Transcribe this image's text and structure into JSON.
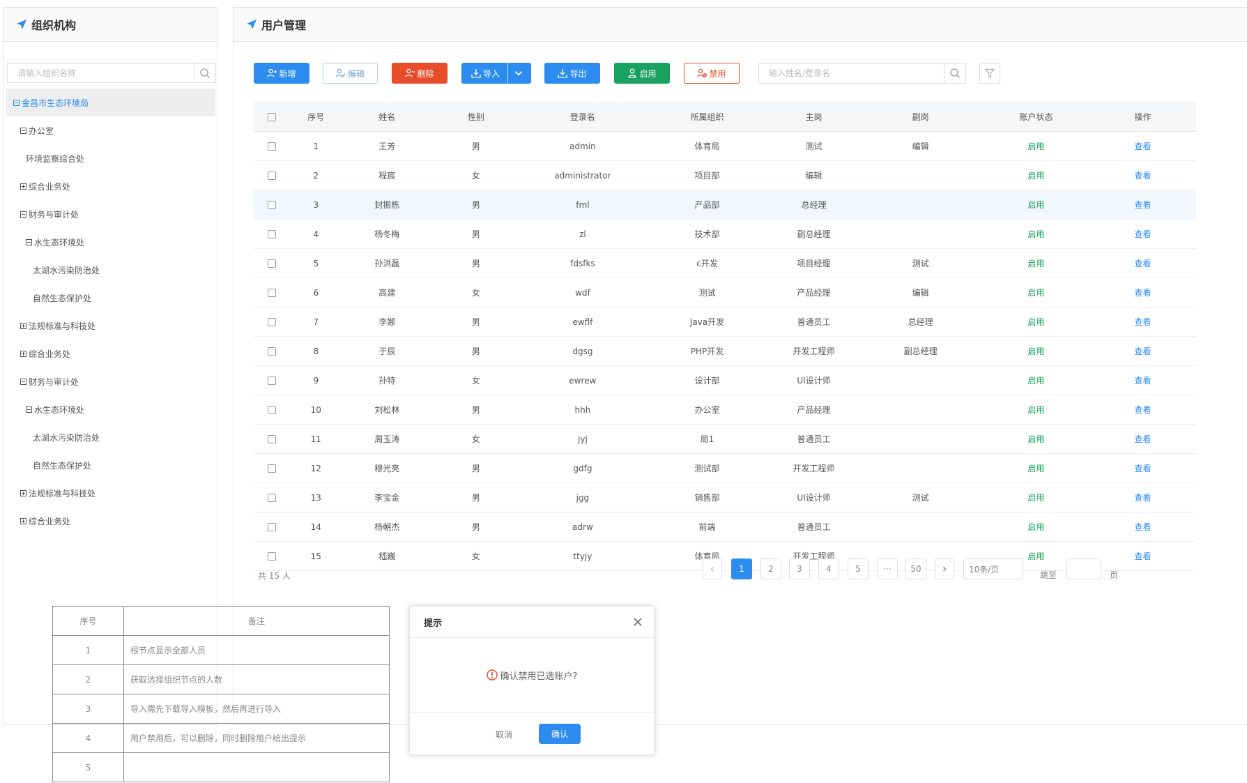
{
  "left_panel": {
    "title": "组织机构",
    "search_placeholder": "请输入组织名称",
    "tree": [
      {
        "label": "金昌市生态环境局",
        "depth": 0,
        "toggle": "minus",
        "selected": true
      },
      {
        "label": "办公室",
        "depth": 1,
        "toggle": "minus"
      },
      {
        "label": "环境监察综合处",
        "depth": 2,
        "toggle": "none"
      },
      {
        "label": "综合业务处",
        "depth": 1,
        "toggle": "plus"
      },
      {
        "label": "财务与审计处",
        "depth": 1,
        "toggle": "minus"
      },
      {
        "label": "水生态环境处",
        "depth": 2,
        "toggle": "minus"
      },
      {
        "label": "太湖水污染防治处",
        "depth": 3,
        "toggle": "none"
      },
      {
        "label": "自然生态保护处",
        "depth": 3,
        "toggle": "none"
      },
      {
        "label": "法规标准与科技处",
        "depth": 1,
        "toggle": "plus"
      },
      {
        "label": "综合业务处",
        "depth": 1,
        "toggle": "plus"
      },
      {
        "label": "财务与审计处",
        "depth": 1,
        "toggle": "minus"
      },
      {
        "label": "水生态环境处",
        "depth": 2,
        "toggle": "minus"
      },
      {
        "label": "太湖水污染防治处",
        "depth": 3,
        "toggle": "none"
      },
      {
        "label": "自然生态保护处",
        "depth": 3,
        "toggle": "none"
      },
      {
        "label": "法规标准与科技处",
        "depth": 1,
        "toggle": "plus"
      },
      {
        "label": "综合业务处",
        "depth": 1,
        "toggle": "plus"
      }
    ]
  },
  "right_panel": {
    "title": "用户管理",
    "toolbar": {
      "add": "新增",
      "edit": "编辑",
      "delete": "删除",
      "import": "导入",
      "export": "导出",
      "enable": "启用",
      "disable": "禁用",
      "search_placeholder": "输入姓名/登录名"
    },
    "table": {
      "columns": [
        "序号",
        "姓名",
        "性别",
        "登录名",
        "所属组织",
        "主岗",
        "副岗",
        "账户状态",
        "操作"
      ],
      "rows": [
        [
          "1",
          "王芳",
          "男",
          "admin",
          "体育局",
          "测试",
          "编辑",
          "启用",
          "查看"
        ],
        [
          "2",
          "程宸",
          "女",
          "administrator",
          "项目部",
          "编辑",
          "",
          "启用",
          "查看"
        ],
        [
          "3",
          "封振栋",
          "男",
          "fml",
          "产品部",
          "总经理",
          "",
          "启用",
          "查看"
        ],
        [
          "4",
          "杨冬梅",
          "男",
          "zl",
          "技术部",
          "副总经理",
          "",
          "启用",
          "查看"
        ],
        [
          "5",
          "孙洪磊",
          "男",
          "fdsfks",
          "c开发",
          "项目经理",
          "测试",
          "启用",
          "查看"
        ],
        [
          "6",
          "高建",
          "女",
          "wdf",
          "测试",
          "产品经理",
          "编辑",
          "启用",
          "查看"
        ],
        [
          "7",
          "李娜",
          "男",
          "ewflf",
          "Java开发",
          "普通员工",
          "总经理",
          "启用",
          "查看"
        ],
        [
          "8",
          "于辰",
          "男",
          "dgsg",
          "PHP开发",
          "开发工程师",
          "副总经理",
          "启用",
          "查看"
        ],
        [
          "9",
          "孙特",
          "女",
          "ewrew",
          "设计部",
          "UI设计师",
          "",
          "启用",
          "查看"
        ],
        [
          "10",
          "刘松林",
          "男",
          "hhh",
          "办公室",
          "产品经理",
          "",
          "启用",
          "查看"
        ],
        [
          "11",
          "周玉涛",
          "女",
          "jyj",
          "局1",
          "普通员工",
          "",
          "启用",
          "查看"
        ],
        [
          "12",
          "穆光亮",
          "男",
          "gdfg",
          "测试部",
          "开发工程师",
          "",
          "启用",
          "查看"
        ],
        [
          "13",
          "李宝金",
          "男",
          "jgg",
          "销售部",
          "UI设计师",
          "测试",
          "启用",
          "查看"
        ],
        [
          "14",
          "杨朝杰",
          "男",
          "adrw",
          "前端",
          "普通员工",
          "",
          "启用",
          "查看"
        ],
        [
          "15",
          "嵇巍",
          "女",
          "ttyjy",
          "体育局",
          "开发工程师",
          "",
          "启用",
          "查看"
        ]
      ],
      "highlighted_row": 3
    },
    "pagination": {
      "total": "共 15 人",
      "pages": [
        "1",
        "2",
        "3",
        "4",
        "5",
        "···",
        "50"
      ],
      "current": "1",
      "page_size": "10条/页",
      "goto_label": "跳至",
      "page_suffix": "页"
    }
  },
  "notes_table": {
    "columns": [
      "序号",
      "备注"
    ],
    "rows": [
      [
        "1",
        "根节点显示全部人员"
      ],
      [
        "2",
        "获取选择组织节点的人数"
      ],
      [
        "3",
        "导入需先下载导入模板，然后再进行导入"
      ],
      [
        "4",
        "用户禁用后，可以删除，同时删除用户给出提示"
      ],
      [
        "5",
        ""
      ]
    ]
  },
  "dialog": {
    "title": "提示",
    "message": "确认禁用已选账户?",
    "cancel": "取消",
    "confirm": "确认"
  },
  "colors": {
    "primary": "#2d8cf0",
    "danger": "#e74d2a",
    "success": "#19a15f"
  }
}
